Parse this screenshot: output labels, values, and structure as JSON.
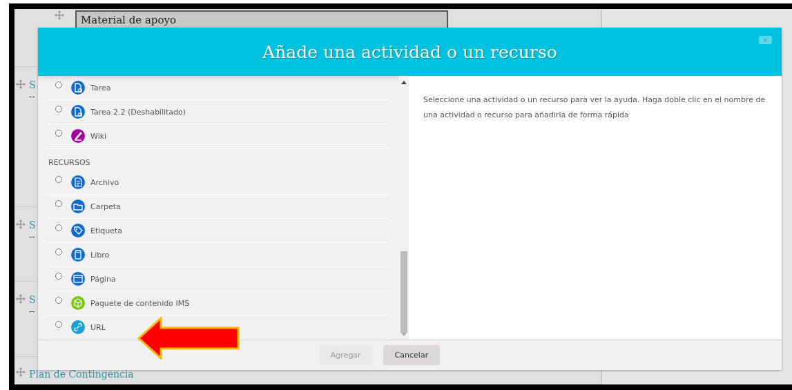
{
  "page": {
    "heading_field": {
      "value": "Material de apoyo"
    },
    "sections": [
      {
        "title": "S",
        "summary": "--"
      },
      {
        "title": "S",
        "summary": "--"
      },
      {
        "title": "S",
        "summary": "--"
      }
    ],
    "last_section": {
      "title": "Plan de Contingencia"
    }
  },
  "dialog": {
    "title": "Añade una actividad o un recurso",
    "close": "×",
    "groups": [
      {
        "items": [
          {
            "label": "Tarea",
            "color": "#0f6cce",
            "selected": false
          },
          {
            "label": "Tarea 2.2 (Deshabilitado)",
            "color": "#0f6cce",
            "selected": false
          },
          {
            "label": "Wiki",
            "color": "#a4009b",
            "selected": false
          }
        ]
      },
      {
        "heading": "RECURSOS",
        "items": [
          {
            "label": "Archivo",
            "color": "#0f6cce",
            "selected": false
          },
          {
            "label": "Carpeta",
            "color": "#0f6cce",
            "selected": false
          },
          {
            "label": "Etiqueta",
            "color": "#0f6cce",
            "selected": false
          },
          {
            "label": "Libro",
            "color": "#0f6cce",
            "selected": false
          },
          {
            "label": "Página",
            "color": "#0f6cce",
            "selected": false
          },
          {
            "label": "Paquete de contenido IMS",
            "color": "#7ac70c",
            "selected": false
          },
          {
            "label": "URL",
            "color": "#1ba1d1",
            "selected": false
          }
        ]
      }
    ],
    "help": "Seleccione una actividad o un recurso para ver la ayuda. Haga doble clic en el nombre de una actividad o recurso para añadirla de forma rápida",
    "buttons": [
      {
        "label": "Agregar",
        "disabled": true
      },
      {
        "label": "Cancelar",
        "disabled": false
      }
    ]
  },
  "annotation": {
    "kind": "arrow"
  }
}
